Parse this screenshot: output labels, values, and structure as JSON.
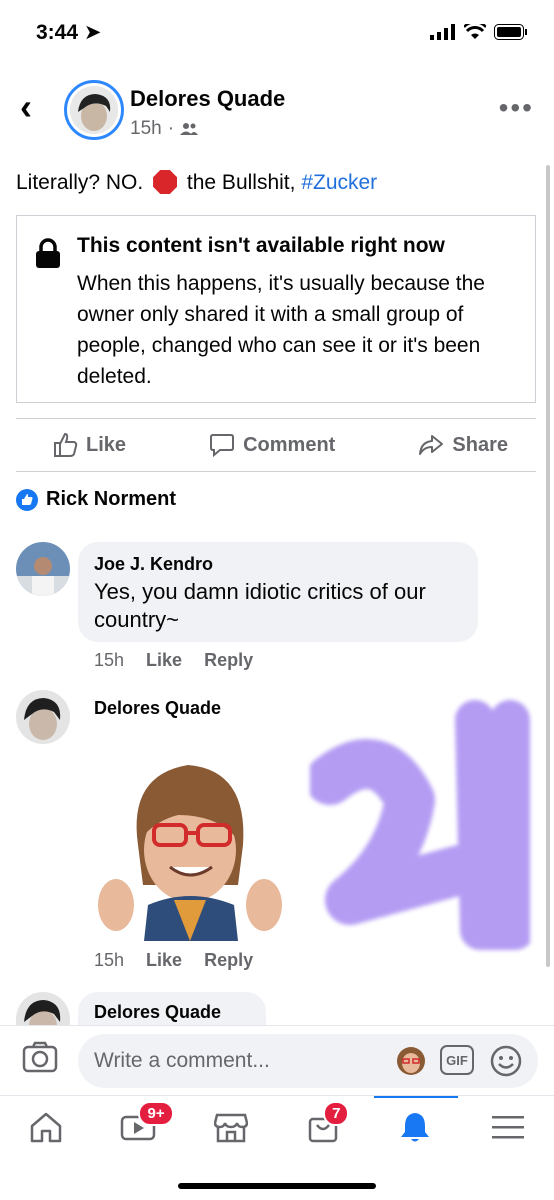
{
  "status": {
    "time": "3:44"
  },
  "post": {
    "author": "Delores Quade",
    "time": "15h",
    "more_label": "•••",
    "text_prefix": "Literally? NO.",
    "text_middle": "the Bullshit,",
    "hashtag": "#Zucker",
    "notice_title": "This content isn't available right now",
    "notice_body": "When this happens, it's usually because the owner only shared it with a small group of people, changed who can see it or it's been deleted."
  },
  "actions": {
    "like": "Like",
    "comment": "Comment",
    "share": "Share"
  },
  "reaction": {
    "name": "Rick Norment"
  },
  "comments": [
    {
      "name": "Joe J. Kendro",
      "text": "Yes, you damn idiotic critics of our country~",
      "time": "15h",
      "like": "Like",
      "reply": "Reply"
    },
    {
      "name": "Delores Quade",
      "time": "15h",
      "like": "Like",
      "reply": "Reply"
    },
    {
      "name": "Delores Quade"
    }
  ],
  "composer": {
    "placeholder": "Write a comment...",
    "gif": "GIF"
  },
  "tabs": {
    "watch_badge": "9+",
    "marketplace_badge": "7"
  },
  "colors": {
    "accent": "#1877f2",
    "hashtag": "#216fdb",
    "badge": "#e41e3f",
    "scribble": "#9c7cf0"
  }
}
